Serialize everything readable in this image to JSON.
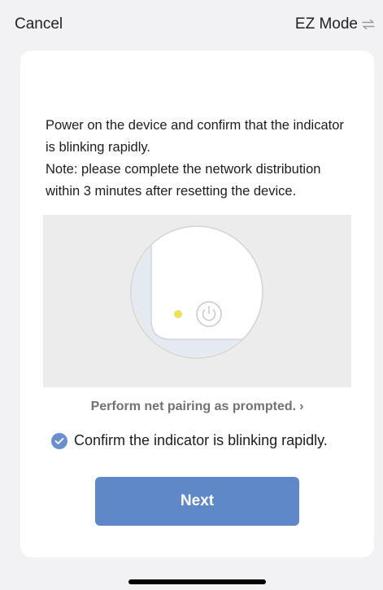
{
  "header": {
    "cancel_label": "Cancel",
    "mode_label": "EZ Mode",
    "mode_icon": "swap-arrows-icon"
  },
  "instructions": {
    "line1": "Power on the device and confirm that the indicator is blinking rapidly.",
    "line2": "Note: please complete the network distribution within 3 minutes after resetting the device."
  },
  "illustration": {
    "indicator_color": "#f0e060",
    "icon": "power-icon"
  },
  "help_link": {
    "label": "Perform net pairing as prompted.",
    "chevron": "›"
  },
  "confirm": {
    "label": "Confirm the indicator is blinking rapidly.",
    "checked": true
  },
  "next_button": {
    "label": "Next"
  },
  "colors": {
    "accent": "#5f88c9",
    "check": "#6a8fd0",
    "background": "#f2f2f4"
  }
}
